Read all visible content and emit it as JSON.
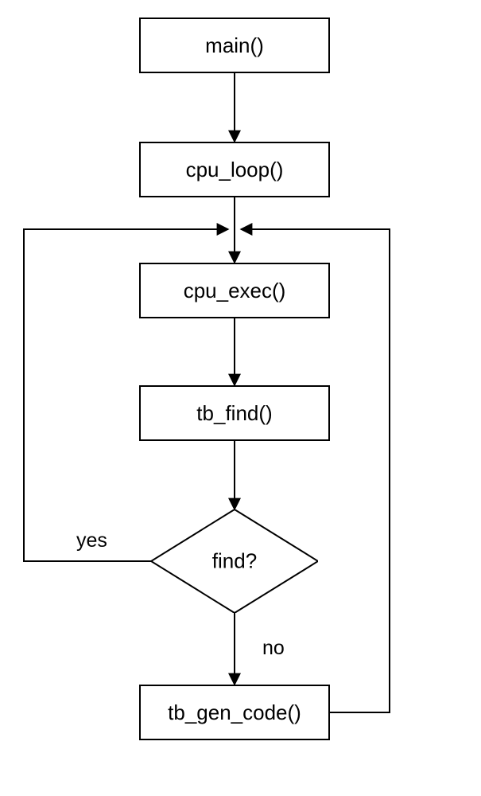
{
  "nodes": {
    "main": {
      "label": "main()"
    },
    "cpu_loop": {
      "label": "cpu_loop()"
    },
    "cpu_exec": {
      "label": "cpu_exec()"
    },
    "tb_find": {
      "label": "tb_find()"
    },
    "find": {
      "label": "find?"
    },
    "tb_gen_code": {
      "label": "tb_gen_code()"
    }
  },
  "edges": {
    "find_yes": "yes",
    "find_no": "no"
  }
}
